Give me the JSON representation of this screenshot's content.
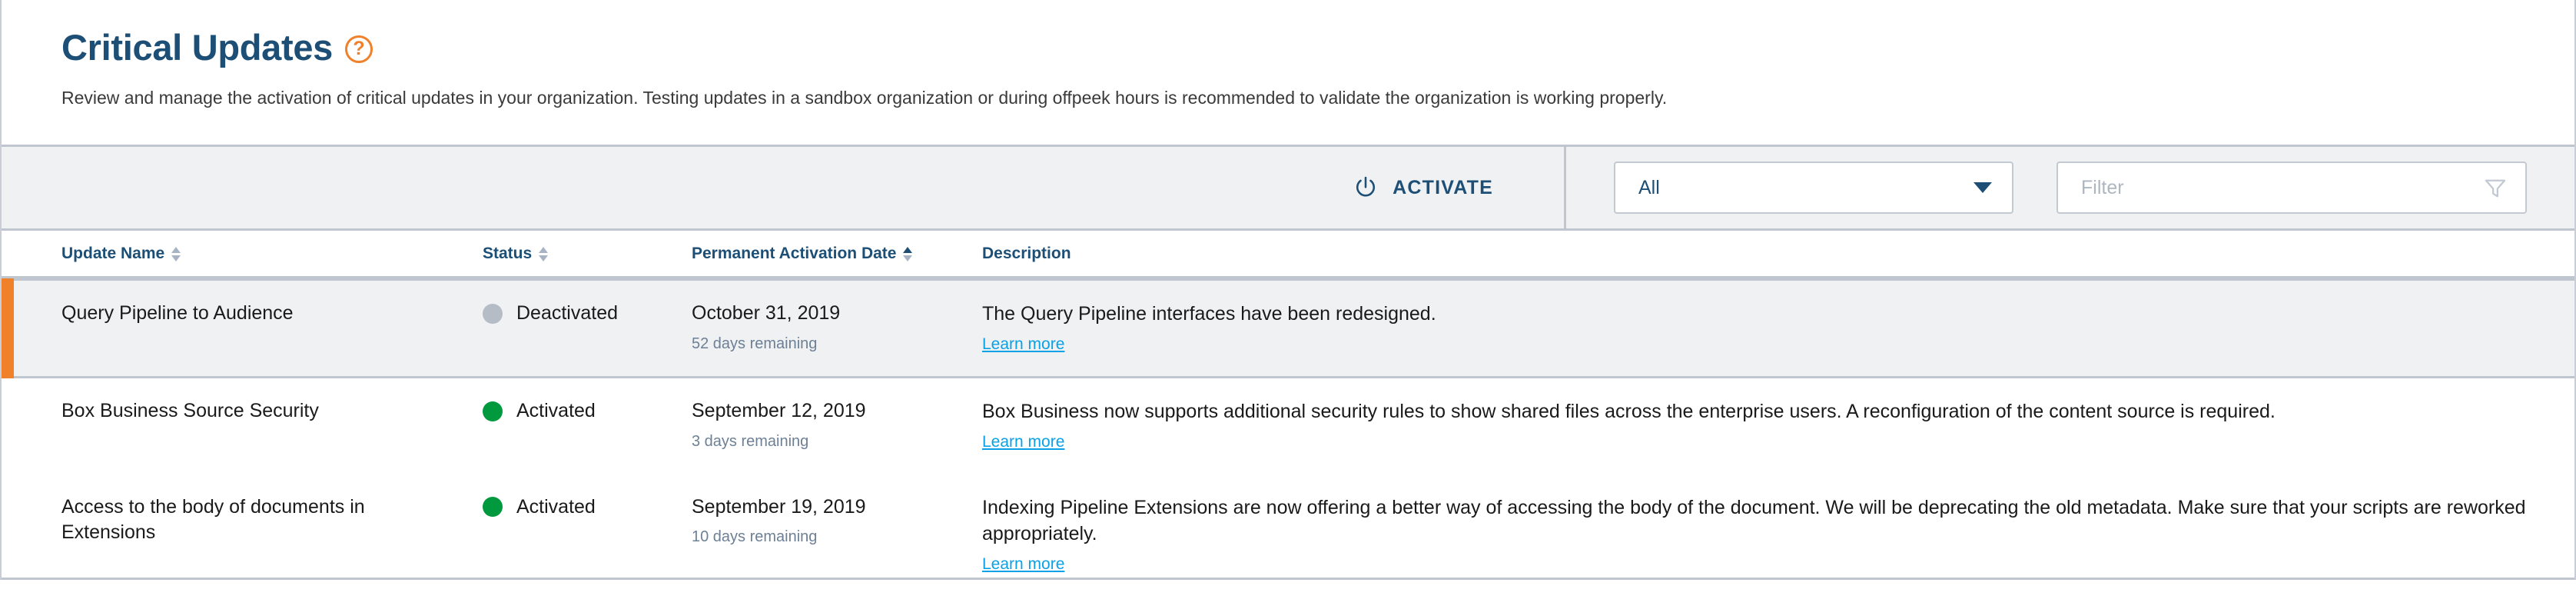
{
  "header": {
    "title": "Critical Updates",
    "help_icon": "help-circle-icon",
    "help_glyph": "?",
    "subtitle": "Review and manage the activation of critical updates in your organization. Testing updates in a sandbox organization or during offpeek hours is recommended to validate the organization is working properly."
  },
  "toolbar": {
    "activate_label": "ACTIVATE",
    "activate_icon": "power-icon",
    "filter_select": {
      "value": "All",
      "options": [
        "All"
      ],
      "caret_icon": "chevron-down-icon"
    },
    "filter_input": {
      "value": "",
      "placeholder": "Filter",
      "icon": "funnel-icon"
    }
  },
  "table": {
    "columns": [
      {
        "label": "Update Name",
        "sortable": true,
        "sort": "none"
      },
      {
        "label": "Status",
        "sortable": true,
        "sort": "none"
      },
      {
        "label": "Permanent Activation Date",
        "sortable": true,
        "sort": "asc"
      },
      {
        "label": "Description",
        "sortable": false,
        "sort": "none"
      }
    ],
    "rows": [
      {
        "name": "Query Pipeline to Audience",
        "status": "Deactivated",
        "status_color": "#b5bcc6",
        "date": "October 31, 2019",
        "days_remaining": "52 days remaining",
        "description": "The Query Pipeline interfaces have been redesigned.",
        "link_label": "Learn more",
        "selected": true
      },
      {
        "name": "Box Business Source Security",
        "status": "Activated",
        "status_color": "#00993d",
        "date": "September 12, 2019",
        "days_remaining": "3 days remaining",
        "description": "Box Business now supports additional security rules to show shared files across the enterprise users. A reconfiguration of the content source is required.",
        "link_label": "Learn more",
        "selected": false
      },
      {
        "name": "Access to the body of documents in Extensions",
        "status": "Activated",
        "status_color": "#00993d",
        "date": "September 19, 2019",
        "days_remaining": "10 days remaining",
        "description": "Indexing Pipeline Extensions are now offering a better way of accessing the body of the document. We will be deprecating the old metadata. Make sure that your scripts are reworked appropriately.",
        "link_label": "Learn more",
        "selected": false
      }
    ]
  },
  "colors": {
    "brand_blue": "#1d4f76",
    "accent_orange": "#f0812a",
    "link_blue": "#0aa1e6",
    "status_green": "#00993d",
    "status_grey": "#b5bcc6",
    "toolbar_bg": "#eff1f3",
    "border": "#c0c6d0"
  }
}
